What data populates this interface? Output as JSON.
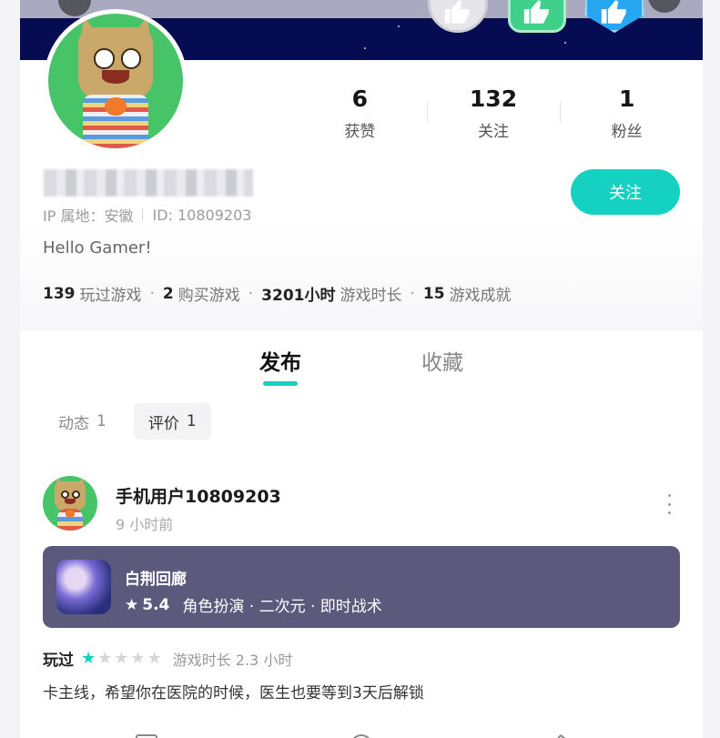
{
  "profile": {
    "stats": [
      {
        "value": "6",
        "label": "获赞"
      },
      {
        "value": "132",
        "label": "关注"
      },
      {
        "value": "1",
        "label": "粉丝"
      }
    ],
    "follow_label": "关注",
    "ip_label": "IP 属地：安徽",
    "id_label": "ID: 10809203",
    "bio": "Hello Gamer!",
    "summary": [
      {
        "value": "139",
        "label": "玩过游戏"
      },
      {
        "value": "2",
        "label": "购买游戏"
      },
      {
        "value": "3201小时",
        "label": "游戏时长"
      },
      {
        "value": "15",
        "label": "游戏成就"
      }
    ]
  },
  "tabs": [
    {
      "label": "发布",
      "active": true
    },
    {
      "label": "收藏",
      "active": false
    }
  ],
  "subtabs": [
    {
      "label": "动态",
      "count": "1",
      "selected": false
    },
    {
      "label": "评价",
      "count": "1",
      "selected": true
    }
  ],
  "post": {
    "username": "手机用户10809203",
    "time": "9 小时前",
    "game": {
      "title": "白荆回廊",
      "score": "5.4",
      "tags": "角色扮演 · 二次元 · 即时战术"
    },
    "rating_tag": "玩过",
    "stars_filled": 1,
    "stars_total": 5,
    "play_time": "游戏时长 2.3 小时",
    "review": "卡主线，希望你在医院的时候，医生也要等到3天后解锁"
  },
  "colors": {
    "accent": "#15d1c2",
    "game_card_bg": "#5c5a7c",
    "avatar_bg": "#47c468"
  }
}
